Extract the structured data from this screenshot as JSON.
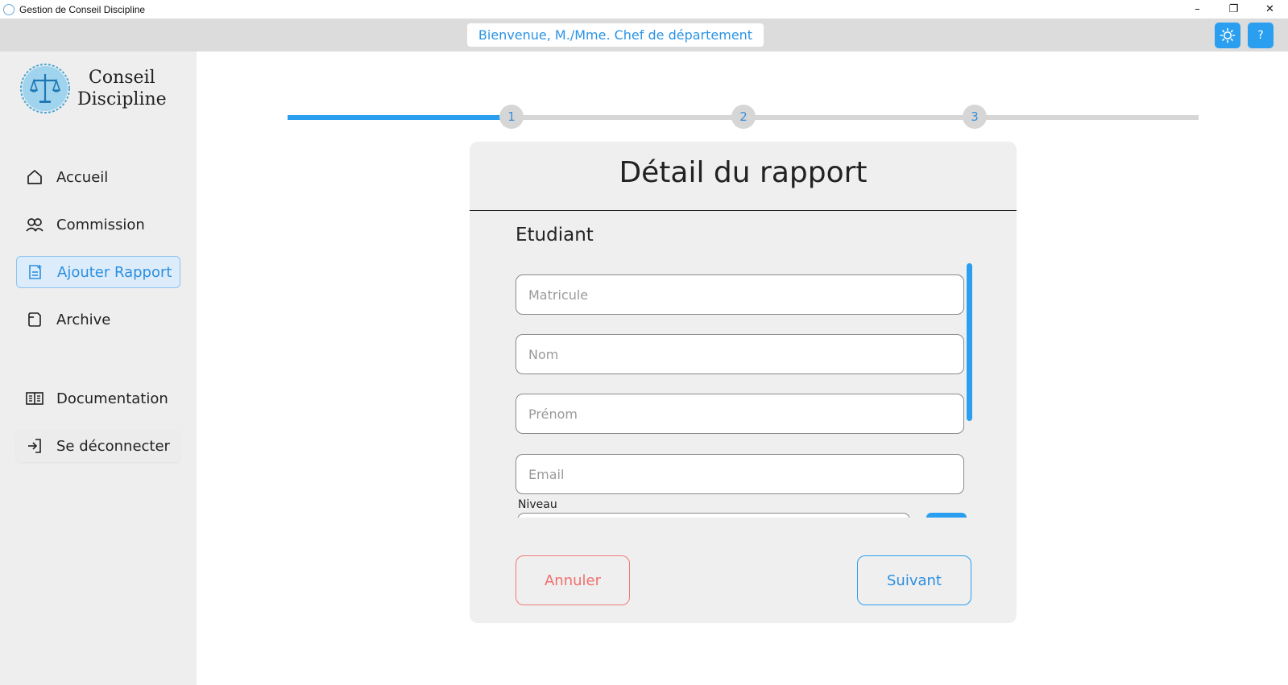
{
  "window": {
    "title": "Gestion de Conseil Discipline",
    "controls": {
      "minimize": "–",
      "maximize": "❐",
      "close": "✕"
    }
  },
  "header": {
    "welcome": "Bienvenue, M./Mme. Chef de département",
    "theme_icon": "sun-icon",
    "help_label": "?"
  },
  "sidebar": {
    "logo_line1": "Conseil",
    "logo_line2": "Discipline",
    "items": [
      {
        "label": "Accueil",
        "icon": "home-icon"
      },
      {
        "label": "Commission",
        "icon": "users-icon"
      },
      {
        "label": "Ajouter Rapport",
        "icon": "add-report-icon",
        "active": true
      },
      {
        "label": "Archive",
        "icon": "archive-icon"
      },
      {
        "label": "Documentation",
        "icon": "book-icon"
      },
      {
        "label": "Se déconnecter",
        "icon": "logout-icon"
      }
    ]
  },
  "stepper": {
    "steps": [
      "1",
      "2",
      "3"
    ],
    "current": 1
  },
  "form": {
    "title": "Détail du rapport",
    "section": "Etudiant",
    "fields": {
      "matricule": {
        "placeholder": "Matricule",
        "value": ""
      },
      "nom": {
        "placeholder": "Nom",
        "value": ""
      },
      "prenom": {
        "placeholder": "Prénom",
        "value": ""
      },
      "email": {
        "placeholder": "Email",
        "value": ""
      }
    },
    "niveau_label": "Niveau",
    "cancel_label": "Annuler",
    "next_label": "Suivant"
  },
  "colors": {
    "accent": "#2a9ff0",
    "danger": "#ef7070",
    "sidebar_bg": "#eeeeee",
    "header_bg": "#dcdcdc"
  }
}
